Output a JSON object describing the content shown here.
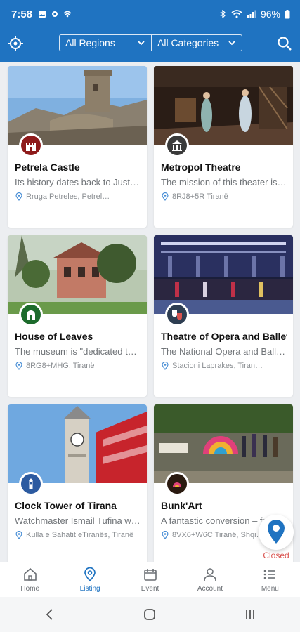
{
  "status_bar": {
    "time": "7:58",
    "battery": "96%"
  },
  "header": {
    "region_filter": "All Regions",
    "category_filter": "All Categories"
  },
  "listings": [
    {
      "title": "Petrela Castle",
      "description": "Its history dates back to Just…",
      "address": "Rruga Petreles, Petrel…",
      "icon": "castle-icon"
    },
    {
      "title": "Metropol Theatre",
      "description": "The mission of this theater is…",
      "address": "8RJ8+5R Tiranë",
      "icon": "theatre-building-icon"
    },
    {
      "title": "House of Leaves",
      "description": "The museum is \"dedicated to…",
      "address": "8RG8+MHG, Tiranë",
      "icon": "museum-icon"
    },
    {
      "title": "Theatre of Opera and Ballet",
      "description": "The National Opera and Balle…",
      "address": "Stacioni Laprakes, Tiran…",
      "icon": "theatre-masks-icon"
    },
    {
      "title": "Clock Tower of Tirana",
      "description": "Watchmaster Ismail Tufina w…",
      "address": "Kulla e Sahatit eTiranës, Tiranë",
      "icon": "tower-icon"
    },
    {
      "title": "Bunk'Art",
      "description": "A fantastic conversion – fr…",
      "address": "8VX6+W6C Tiranë, Shqi…",
      "icon": "bunkart-logo-icon"
    }
  ],
  "map_button": {
    "status": "Closed"
  },
  "tabs": [
    {
      "label": "Home",
      "icon": "home-icon"
    },
    {
      "label": "Listing",
      "icon": "location-pin-icon",
      "active": true
    },
    {
      "label": "Event",
      "icon": "calendar-icon"
    },
    {
      "label": "Account",
      "icon": "person-icon"
    },
    {
      "label": "Menu",
      "icon": "menu-list-icon"
    }
  ],
  "colors": {
    "primary": "#1f73c1",
    "closed": "#d9534f",
    "badge_castle": "#8e1b1b",
    "badge_leaves": "#1d6b2c",
    "badge_tower": "#2c5aa0",
    "badge_masks": "#2e3e52"
  }
}
